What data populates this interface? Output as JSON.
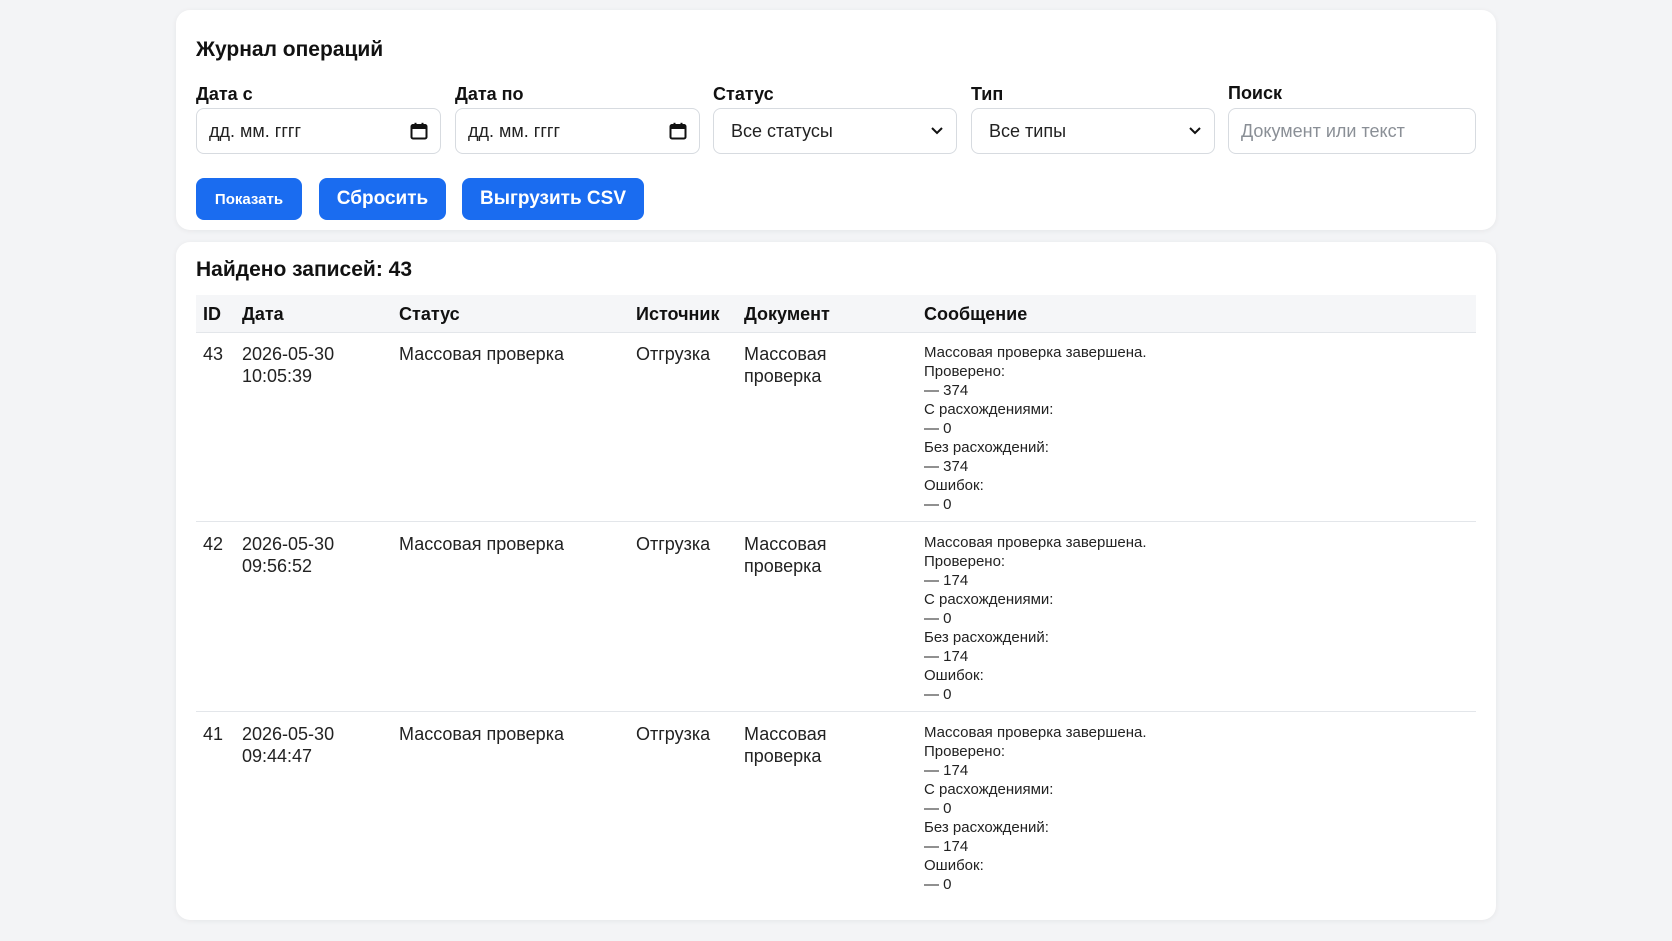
{
  "filters": {
    "title": "Журнал операций",
    "date_from": {
      "label": "Дата с",
      "value": "дд. мм. гггг"
    },
    "date_to": {
      "label": "Дата по",
      "value": "дд. мм. гггг"
    },
    "status": {
      "label": "Статус",
      "value": "Все статусы"
    },
    "type": {
      "label": "Тип",
      "value": "Все типы"
    },
    "search": {
      "label": "Поиск",
      "placeholder": "Документ или текст"
    },
    "buttons": {
      "show": "Показать",
      "reset": "Сбросить",
      "export": "Выгрузить CSV"
    }
  },
  "results": {
    "count_label": "Найдено записей: 43",
    "columns": [
      "ID",
      "Дата",
      "Статус",
      "Источник",
      "Документ",
      "Сообщение"
    ],
    "rows": [
      {
        "id": "43",
        "date": "2026-05-30",
        "time": "10:05:39",
        "status": "Массовая проверка",
        "source": "Отгрузка",
        "doc_line1": "Массовая",
        "doc_line2": "проверка",
        "message": [
          "Массовая проверка завершена.",
          "Проверено:",
          "— 374",
          "С расхождениями:",
          "— 0",
          "Без расхождений:",
          "— 374",
          "Ошибок:",
          "— 0"
        ]
      },
      {
        "id": "42",
        "date": "2026-05-30",
        "time": "09:56:52",
        "status": "Массовая проверка",
        "source": "Отгрузка",
        "doc_line1": "Массовая",
        "doc_line2": "проверка",
        "message": [
          "Массовая проверка завершена.",
          "Проверено:",
          "— 174",
          "С расхождениями:",
          "— 0",
          "Без расхождений:",
          "— 174",
          "Ошибок:",
          "— 0"
        ]
      },
      {
        "id": "41",
        "date": "2026-05-30",
        "time": "09:44:47",
        "status": "Массовая проверка",
        "source": "Отгрузка",
        "doc_line1": "Массовая",
        "doc_line2": "проверка",
        "message": [
          "Массовая проверка завершена.",
          "Проверено:",
          "— 174",
          "С расхождениями:",
          "— 0",
          "Без расхождений:",
          "— 174",
          "Ошибок:",
          "— 0"
        ]
      }
    ]
  },
  "colors": {
    "accent": "#1a6cf0",
    "background": "#f3f4f6",
    "card": "#ffffff"
  },
  "icons": {
    "date": "calendar-icon",
    "select": "chevron-down-icon"
  }
}
